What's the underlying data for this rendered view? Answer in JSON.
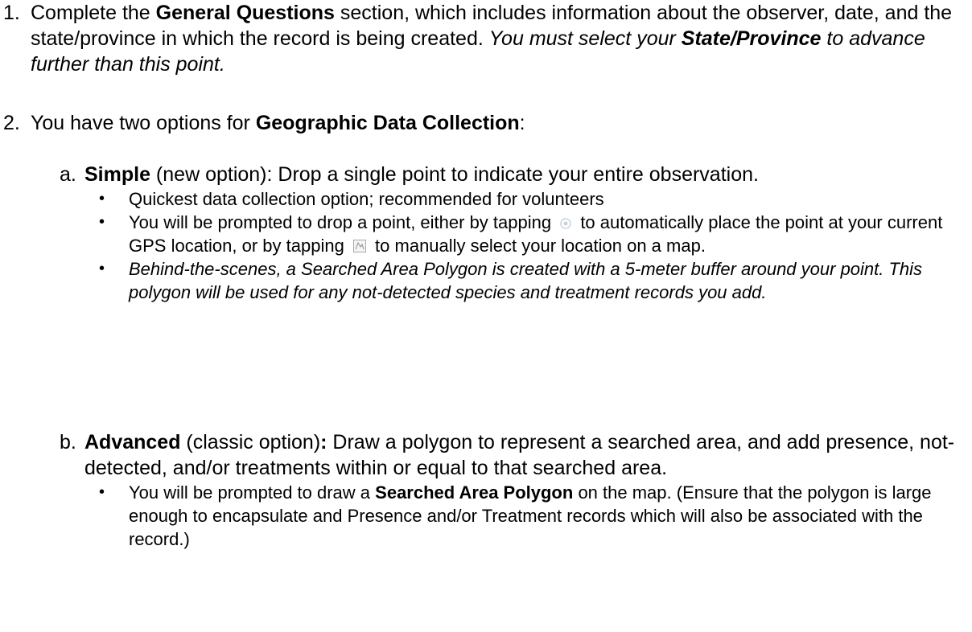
{
  "step1": {
    "number": "1.",
    "text_before": "Complete the ",
    "section_name": "General Questions",
    "text_after": " section, which includes information about the observer, date, and the state/province in which the record is being created. ",
    "italic_before": "You must select your ",
    "italic_bold": "State/Province",
    "italic_after": " to advance further than this point."
  },
  "step2": {
    "number": "2.",
    "text_before": "You have two options for ",
    "section_name": "Geographic Data Collection",
    "text_after": ":"
  },
  "option_a": {
    "letter": "a.",
    "name": "Simple",
    "description": " (new option): Drop a single point to indicate your entire observation.",
    "bullet1": "Quickest data collection option; recommended for volunteers",
    "bullet2_part1": "You will be prompted to drop a point, either by tapping ",
    "bullet2_part2": " to automatically place the point at your current GPS location, or by tapping ",
    "bullet2_part3": " to manually select your location on a map.",
    "bullet3": "Behind-the-scenes, a Searched Area Polygon is created with a 5-meter buffer around your point. This polygon will be used for any not-detected species and treatment records you add.",
    "gps_icon": "gps-locate-icon",
    "map_icon": "map-select-icon"
  },
  "option_b": {
    "letter": "b.",
    "name": "Advanced",
    "description_part1": " (classic option)",
    "description_colon": ":",
    "description_part2": " Draw a polygon to represent a searched area, and add presence, not-detected, and/or treatments within or equal to that searched area.",
    "bullet1_part1": "You will be prompted to draw a ",
    "bullet1_bold": "Searched Area Polygon",
    "bullet1_part2": " on the map. (Ensure that the polygon is large enough to encapsulate and Presence and/or Treatment records which will also be associated with the record.)"
  },
  "bullet_symbol": "•"
}
